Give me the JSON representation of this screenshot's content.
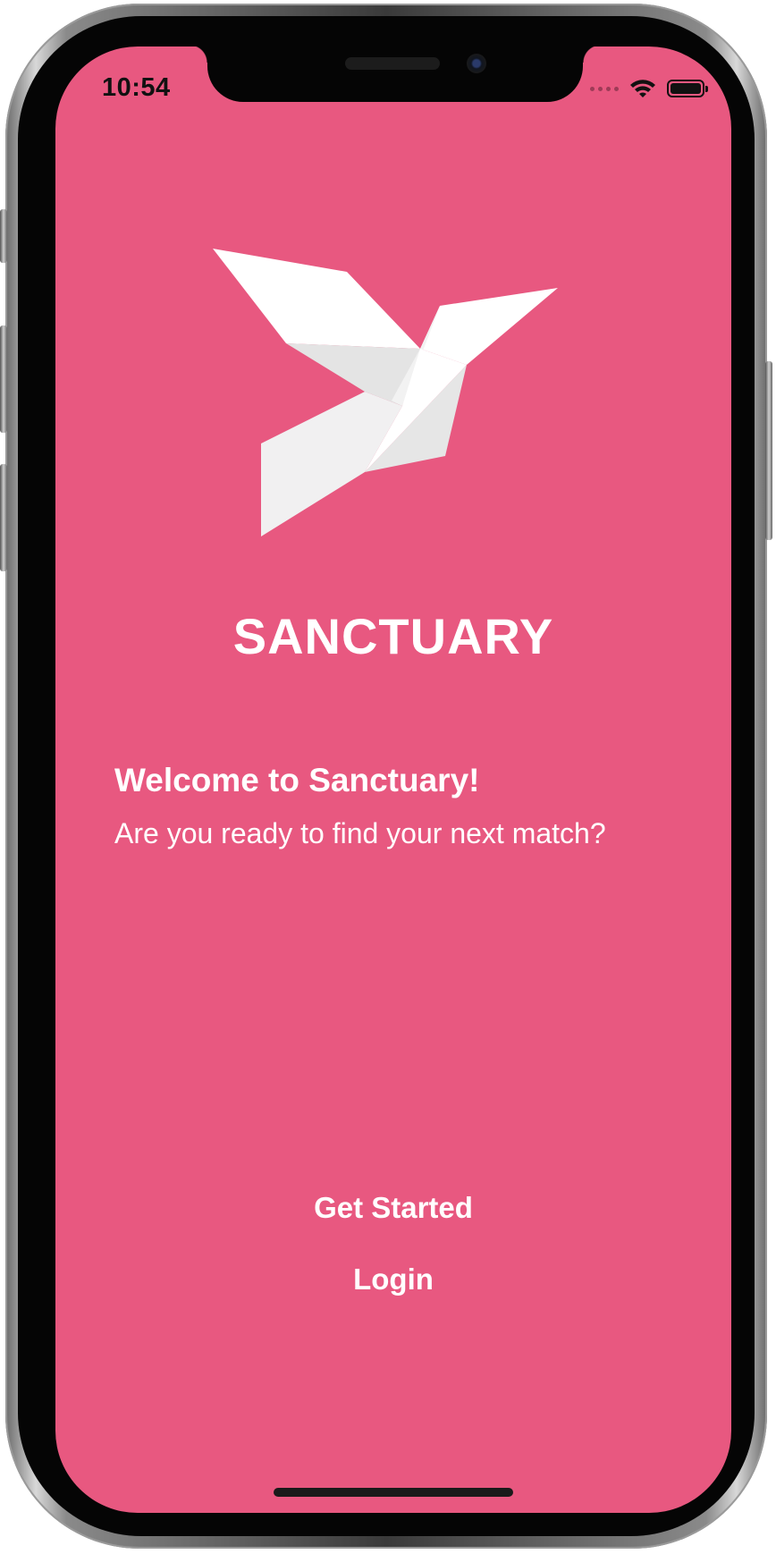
{
  "status_bar": {
    "time": "10:54",
    "icons": [
      "signal-dots-icon",
      "wifi-icon",
      "battery-icon"
    ]
  },
  "app": {
    "brand": "SANCTUARY",
    "logo_icon": "origami-bird-logo",
    "welcome_title": "Welcome to Sanctuary!",
    "welcome_subtitle": "Are you ready to find your next match?",
    "get_started_label": "Get Started",
    "login_label": "Login"
  },
  "colors": {
    "background": "#e85880",
    "text": "#ffffff",
    "logo_light": "#ffffff",
    "logo_shade": "#e4e4e4"
  }
}
